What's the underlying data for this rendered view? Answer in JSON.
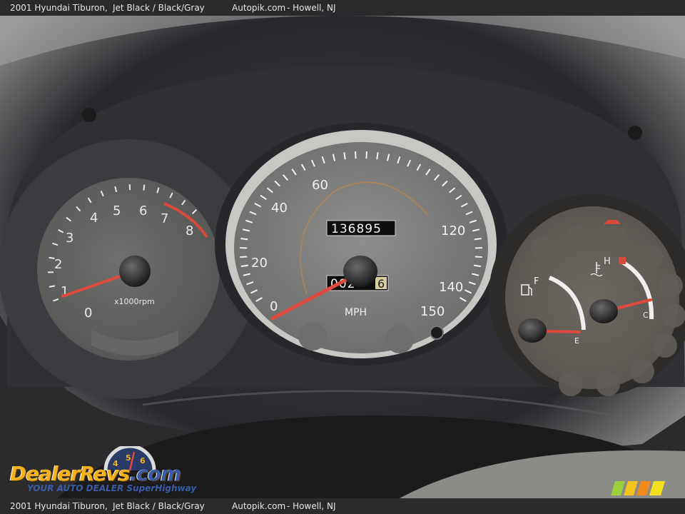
{
  "caption": {
    "vehicle": "2001 Hyundai Tiburon,",
    "color": "Jet Black / Black/Gray",
    "site": "Autopik.com",
    "location": "- Howell, NJ"
  },
  "tachometer": {
    "ticks": [
      "0",
      "1",
      "2",
      "3",
      "4",
      "5",
      "6",
      "7",
      "8"
    ],
    "unit": "x1000rpm"
  },
  "speedometer": {
    "ticks": [
      "0",
      "20",
      "40",
      "60",
      "120",
      "140",
      "150"
    ],
    "unit": "MPH",
    "odometer": "136895",
    "trip": "002",
    "trip_tenths": "6"
  },
  "fuel_gauge": {
    "full": "F",
    "empty": "E"
  },
  "temp_gauge": {
    "hot": "H",
    "cold": "C"
  },
  "watermark": {
    "brand_part1": "DealerRevs",
    "brand_part2": ".com",
    "tagline": "YOUR AUTO DEALER SuperHighway",
    "dial_digits": [
      "4",
      "5",
      "6"
    ]
  },
  "colors": {
    "needle": "#e0493e",
    "redline": "#d84a3a",
    "brand_gold": "#f3b21c",
    "brand_blue": "#3a5ca8"
  }
}
